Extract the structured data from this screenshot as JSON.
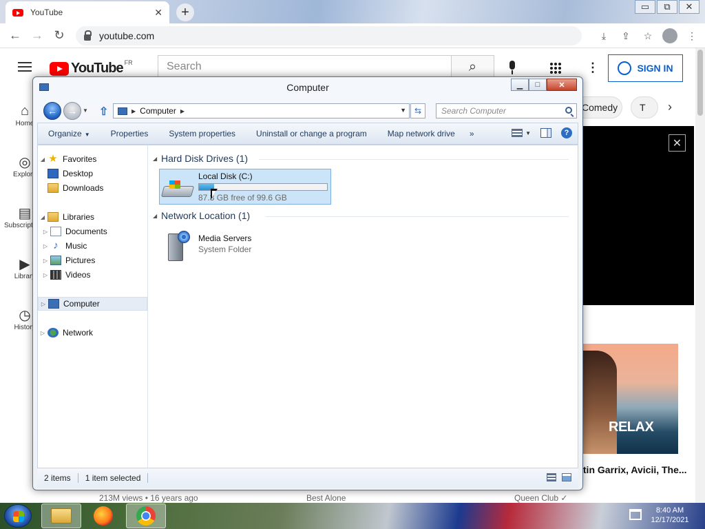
{
  "browser": {
    "tab_title": "YouTube",
    "tab_close": "✕",
    "new_tab": "+",
    "url": "youtube.com",
    "window_controls": [
      "▭",
      "⧉",
      "✕"
    ]
  },
  "youtube": {
    "logo_text": "YouTube",
    "region": "FR",
    "search_placeholder": "Search",
    "sign_in": "SIGN IN",
    "sidebar": [
      {
        "label": "Home",
        "icon": "home-icon"
      },
      {
        "label": "Explore",
        "icon": "compass-icon"
      },
      {
        "label": "Subscriptions",
        "icon": "subscriptions-icon"
      },
      {
        "label": "Library",
        "icon": "library-icon"
      },
      {
        "label": "History",
        "icon": "history-icon"
      }
    ],
    "chips": [
      "Comedy",
      "T"
    ],
    "video_title": "Martin Garrix, Avicii, The...",
    "thumbnail_text": "RELAX",
    "bottom_meta": [
      "213M views • 16 years ago",
      "Best Alone",
      "Queen Club ✓"
    ]
  },
  "explorer": {
    "title": "Computer",
    "address": "Computer",
    "search_placeholder": "Search Computer",
    "commands": [
      "Organize",
      "Properties",
      "System properties",
      "Uninstall or change a program",
      "Map network drive"
    ],
    "more": "»",
    "nav": {
      "favorites": "Favorites",
      "desktop": "Desktop",
      "downloads": "Downloads",
      "libraries": "Libraries",
      "documents": "Documents",
      "music": "Music",
      "pictures": "Pictures",
      "videos": "Videos",
      "computer": "Computer",
      "network": "Network"
    },
    "groups": {
      "hard_disk": "Hard Disk Drives (1)",
      "network_location": "Network Location (1)"
    },
    "drive": {
      "name": "Local Disk (C:)",
      "free_text": "87.3 GB free of 99.6 GB",
      "used_fraction": 0.12
    },
    "media_server": {
      "name": "Media Servers",
      "type": "System Folder"
    },
    "status": {
      "items": "2 items",
      "selected": "1 item selected"
    }
  },
  "taskbar": {
    "time": "8:40 AM",
    "date": "12/17/2021"
  }
}
